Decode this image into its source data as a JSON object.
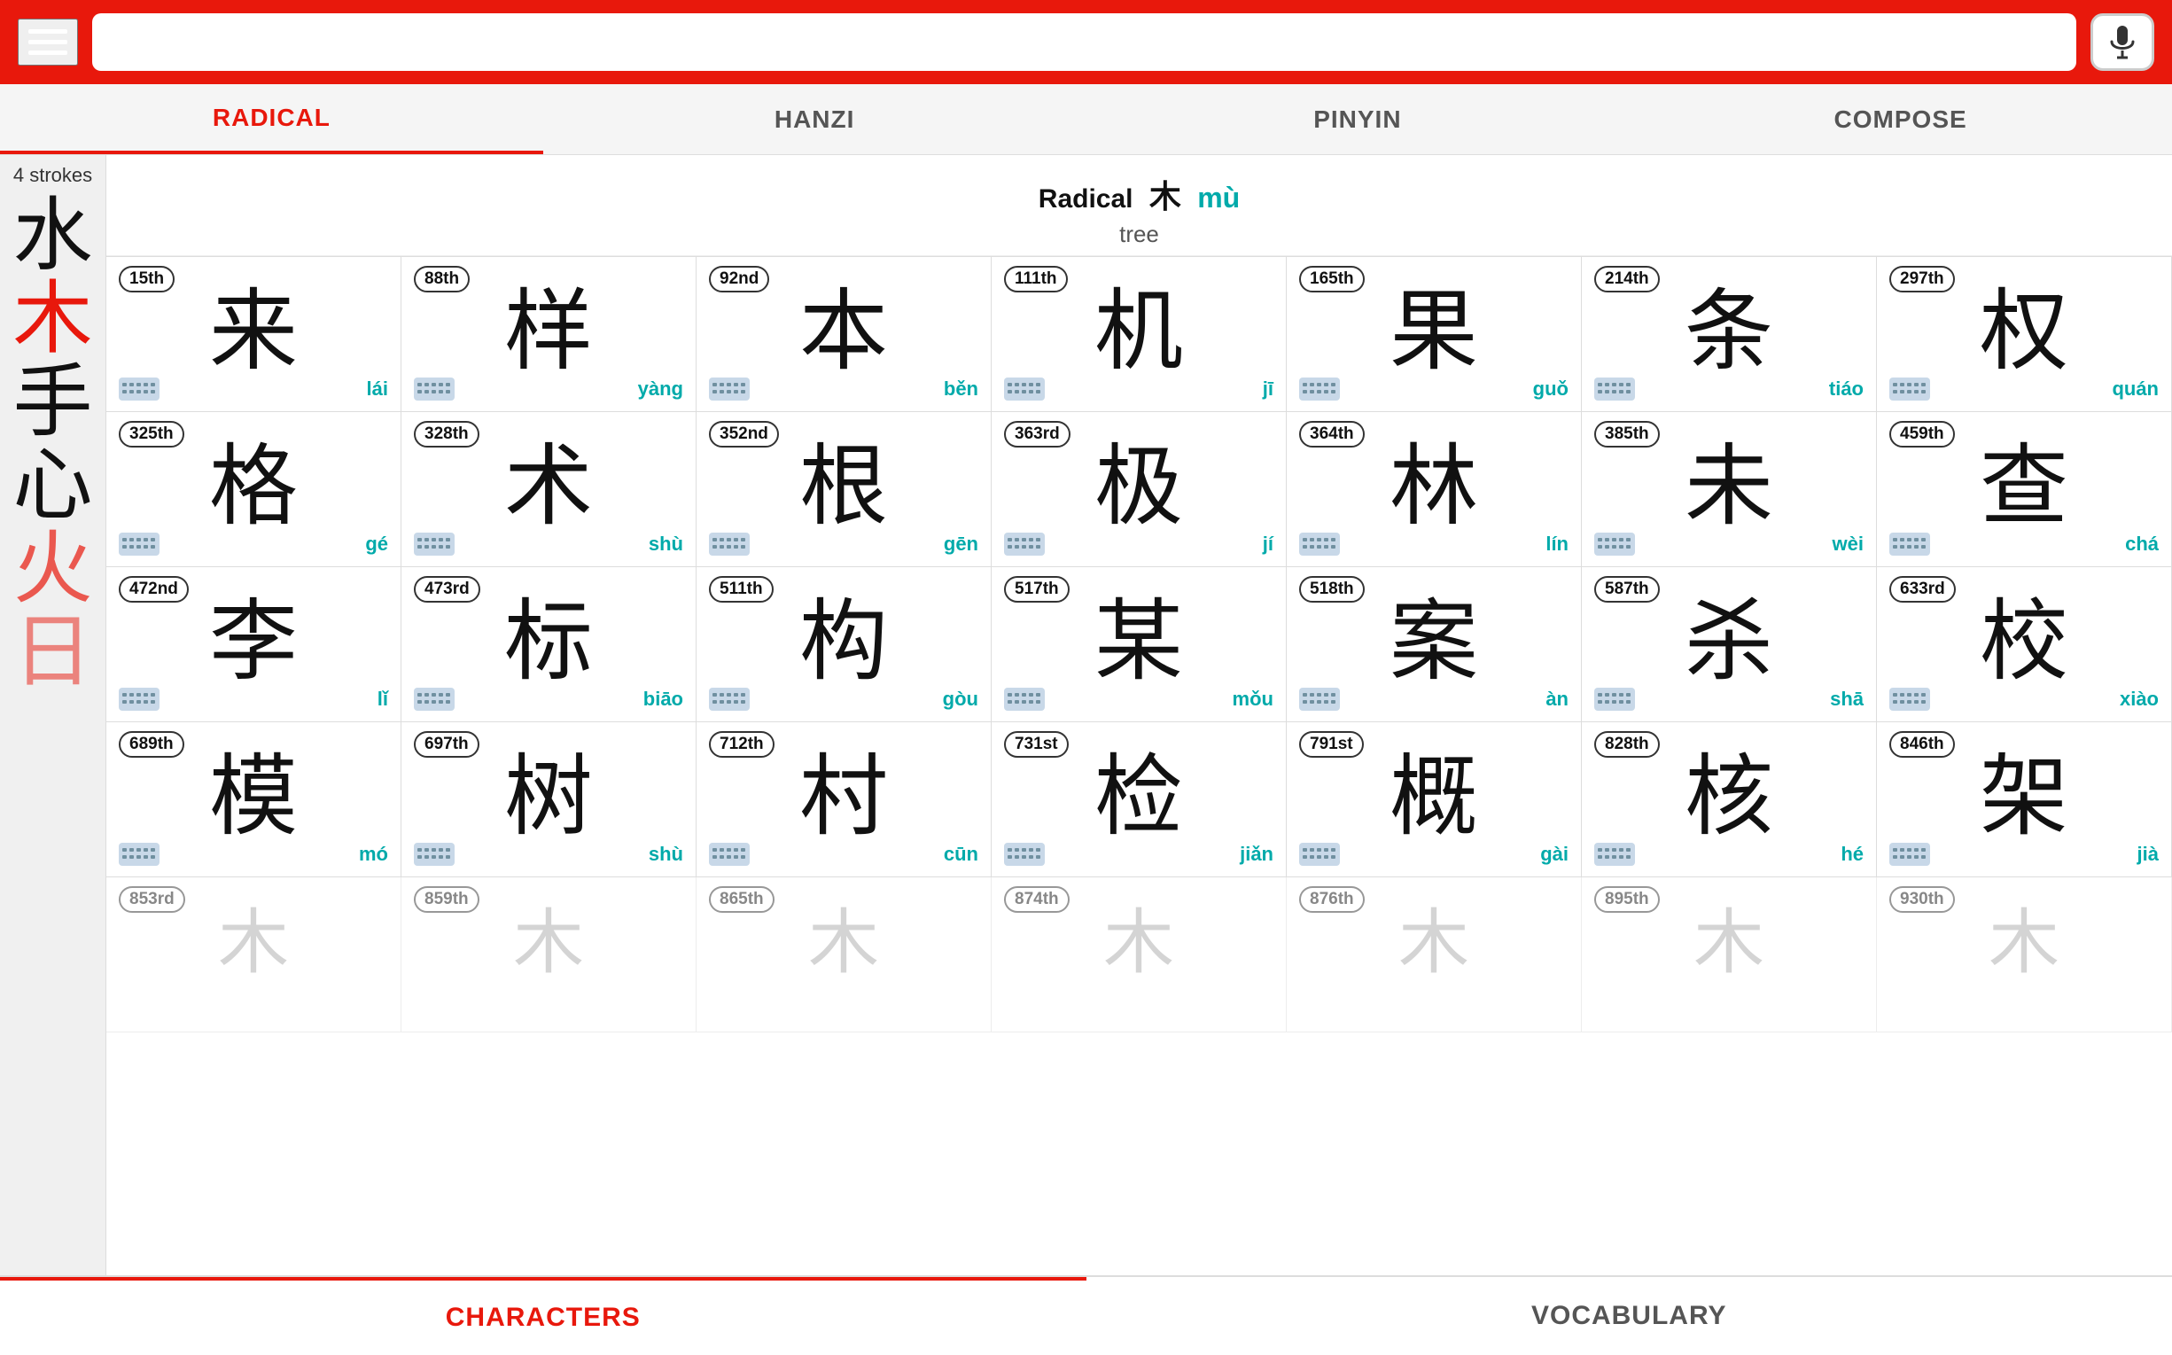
{
  "header": {
    "search_placeholder": "",
    "mic_icon": "🎤"
  },
  "tabs": [
    {
      "label": "RADICAL",
      "active": true
    },
    {
      "label": "HANZI",
      "active": false
    },
    {
      "label": "PINYIN",
      "active": false
    },
    {
      "label": "COMPOSE",
      "active": false
    }
  ],
  "sidebar": {
    "stroke_label": "4 strokes",
    "radicals": [
      {
        "char": "水",
        "active": false
      },
      {
        "char": "木",
        "active": true
      },
      {
        "char": "手",
        "active": false
      },
      {
        "char": "心",
        "active": false
      },
      {
        "char": "火",
        "active": false,
        "partial": true
      },
      {
        "char": "日",
        "active": false
      }
    ]
  },
  "radical_info": {
    "label": "Radical",
    "hanzi": "木",
    "pinyin": "mù",
    "meaning": "tree"
  },
  "characters": [
    {
      "rank": "15th",
      "char": "来",
      "pinyin": "lái"
    },
    {
      "rank": "88th",
      "char": "样",
      "pinyin": "yàng"
    },
    {
      "rank": "92nd",
      "char": "本",
      "pinyin": "běn"
    },
    {
      "rank": "111th",
      "char": "机",
      "pinyin": "jī"
    },
    {
      "rank": "165th",
      "char": "果",
      "pinyin": "guǒ"
    },
    {
      "rank": "214th",
      "char": "条",
      "pinyin": "tiáo"
    },
    {
      "rank": "297th",
      "char": "权",
      "pinyin": "quán"
    },
    {
      "rank": "325th",
      "char": "格",
      "pinyin": "gé"
    },
    {
      "rank": "328th",
      "char": "术",
      "pinyin": "shù"
    },
    {
      "rank": "352nd",
      "char": "根",
      "pinyin": "gēn"
    },
    {
      "rank": "363rd",
      "char": "极",
      "pinyin": "jí"
    },
    {
      "rank": "364th",
      "char": "林",
      "pinyin": "lín"
    },
    {
      "rank": "385th",
      "char": "未",
      "pinyin": "wèi"
    },
    {
      "rank": "459th",
      "char": "查",
      "pinyin": "chá"
    },
    {
      "rank": "472nd",
      "char": "李",
      "pinyin": "lǐ"
    },
    {
      "rank": "473rd",
      "char": "标",
      "pinyin": "biāo"
    },
    {
      "rank": "511th",
      "char": "构",
      "pinyin": "gòu"
    },
    {
      "rank": "517th",
      "char": "某",
      "pinyin": "mǒu"
    },
    {
      "rank": "518th",
      "char": "案",
      "pinyin": "àn"
    },
    {
      "rank": "587th",
      "char": "杀",
      "pinyin": "shā"
    },
    {
      "rank": "633rd",
      "char": "校",
      "pinyin": "xiào"
    },
    {
      "rank": "689th",
      "char": "模",
      "pinyin": "mó"
    },
    {
      "rank": "697th",
      "char": "树",
      "pinyin": "shù"
    },
    {
      "rank": "712th",
      "char": "村",
      "pinyin": "cūn"
    },
    {
      "rank": "731st",
      "char": "检",
      "pinyin": "jiǎn"
    },
    {
      "rank": "791st",
      "char": "概",
      "pinyin": "gài"
    },
    {
      "rank": "828th",
      "char": "核",
      "pinyin": "hé"
    },
    {
      "rank": "846th",
      "char": "架",
      "pinyin": "jià"
    },
    {
      "rank": "853rd",
      "char": "?",
      "pinyin": ""
    },
    {
      "rank": "859th",
      "char": "?",
      "pinyin": ""
    },
    {
      "rank": "865th",
      "char": "?",
      "pinyin": ""
    },
    {
      "rank": "874th",
      "char": "?",
      "pinyin": ""
    },
    {
      "rank": "876th",
      "char": "?",
      "pinyin": ""
    },
    {
      "rank": "895th",
      "char": "?",
      "pinyin": ""
    },
    {
      "rank": "930th",
      "char": "?",
      "pinyin": ""
    }
  ],
  "bottom_tabs": [
    {
      "label": "CHARACTERS",
      "active": true
    },
    {
      "label": "VOCABULARY",
      "active": false
    }
  ],
  "colors": {
    "accent": "#e8180c",
    "pinyin": "#00aaaa"
  }
}
